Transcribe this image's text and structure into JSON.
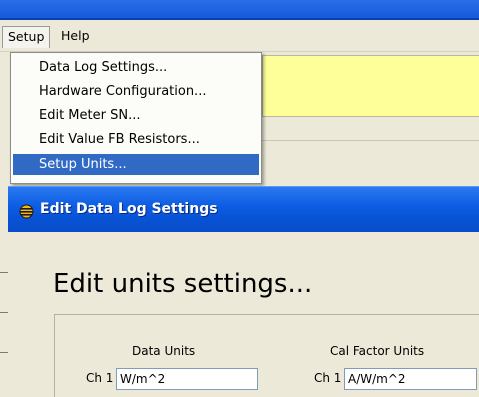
{
  "menubar": {
    "items": [
      {
        "label": "Setup"
      },
      {
        "label": "Help"
      }
    ]
  },
  "setup_menu": {
    "items": [
      {
        "label": "Data Log Settings..."
      },
      {
        "label": "Hardware Configuration..."
      },
      {
        "label": "Edit Meter SN..."
      },
      {
        "label": "Edit Value FB Resistors..."
      },
      {
        "label": "Setup Units...",
        "selected": true
      }
    ]
  },
  "dialog": {
    "title": "Edit Data Log Settings",
    "heading": "Edit units settings...",
    "columns": [
      {
        "header": "Data Units",
        "channel_label": "Ch 1",
        "value": "W/m^2"
      },
      {
        "header": "Cal Factor Units",
        "channel_label": "Ch 1",
        "value": "A/W/m^2"
      }
    ]
  },
  "colors": {
    "title_bar": "#0753d6",
    "menu_highlight": "#316ac5",
    "info_panel": "#ffff99",
    "window_bg": "#ece9d8"
  }
}
